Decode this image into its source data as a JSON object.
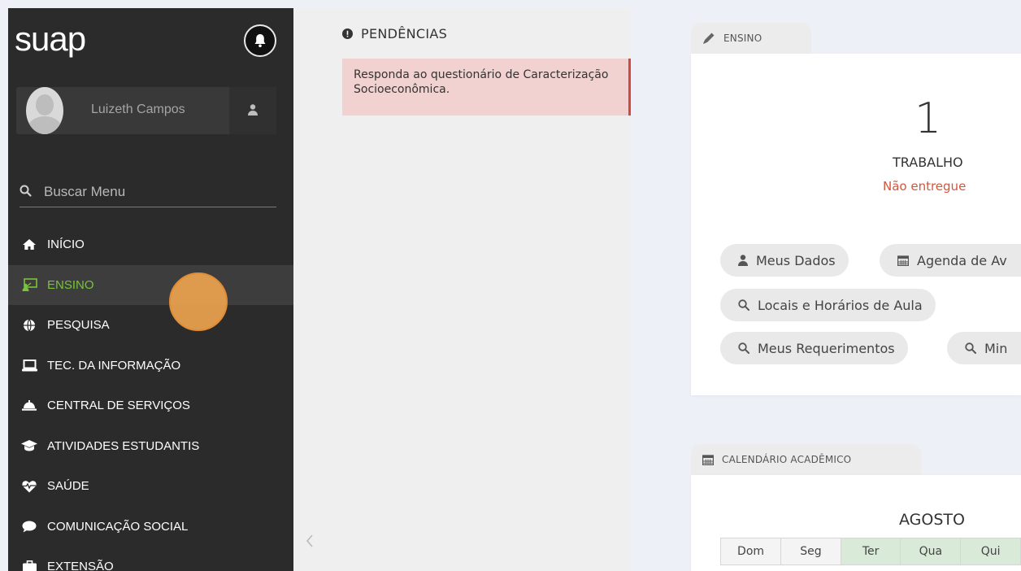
{
  "sidebar": {
    "logo": "suap",
    "user_name": "Luizeth Campos",
    "search_placeholder": "Buscar Menu",
    "menu": [
      {
        "label": "INÍCIO",
        "icon": "home-icon"
      },
      {
        "label": "ENSINO",
        "icon": "classroom-icon",
        "active": true
      },
      {
        "label": "PESQUISA",
        "icon": "globe-icon"
      },
      {
        "label": "TEC. DA INFORMAÇÃO",
        "icon": "laptop-icon"
      },
      {
        "label": "CENTRAL DE SERVIÇOS",
        "icon": "bell-service-icon"
      },
      {
        "label": "ATIVIDADES ESTUDANTIS",
        "icon": "graduation-cap-icon"
      },
      {
        "label": "SAÚDE",
        "icon": "heartbeat-icon"
      },
      {
        "label": "COMUNICAÇÃO SOCIAL",
        "icon": "comment-icon"
      },
      {
        "label": "EXTENSÃO",
        "icon": "briefcase-icon"
      }
    ]
  },
  "pendencias": {
    "title": "PENDÊNCIAS",
    "message": "Responda ao questionário de Caracterização Socioeconômica."
  },
  "ensino": {
    "tab_label": "ENSINO",
    "count": "1",
    "count_label": "TRABALHO",
    "status": "Não entregue",
    "buttons": {
      "meus_dados": "Meus Dados",
      "agenda": "Agenda de Av",
      "locais": "Locais e Horários de Aula",
      "requerimentos": "Meus Requerimentos",
      "min": "Min"
    }
  },
  "calendario": {
    "tab_label": "CALENDÁRIO ACADÊMICO",
    "month": "AGOSTO",
    "weekdays": [
      "Dom",
      "Seg",
      "Ter",
      "Qua",
      "Qui"
    ]
  },
  "colors": {
    "sidebar_bg": "#2b2b2b",
    "accent_green": "#78c43a",
    "alert_red": "#d04a40",
    "status_red": "#d4553b"
  }
}
